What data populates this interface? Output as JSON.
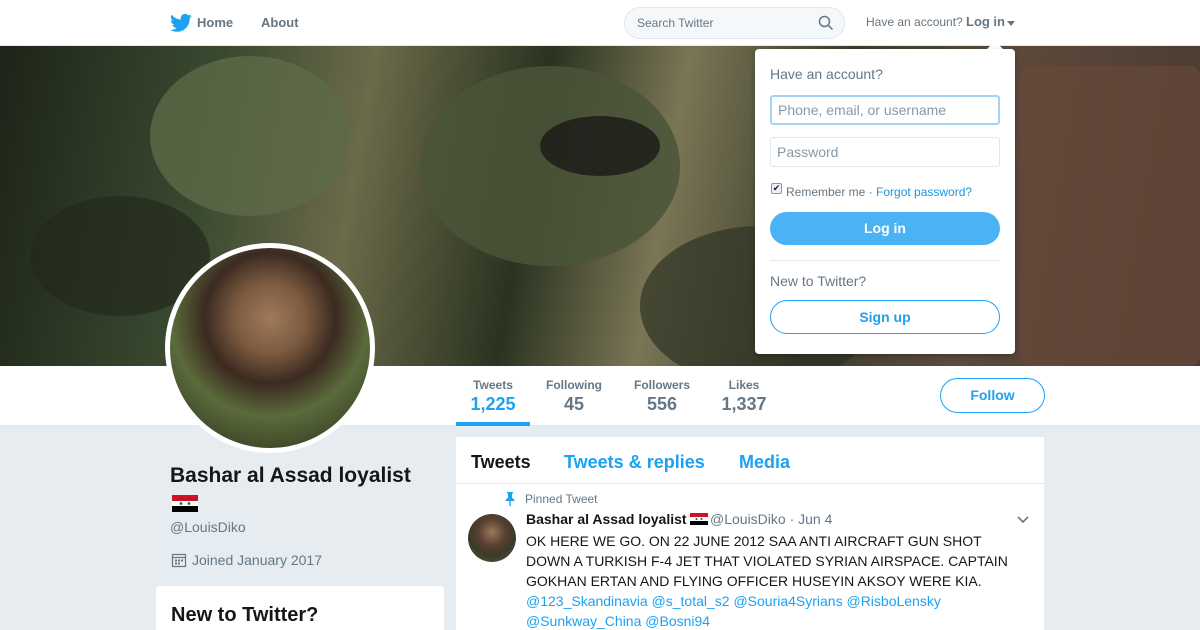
{
  "nav": {
    "home_label": "Home",
    "about_label": "About",
    "search_placeholder": "Search Twitter",
    "login_prompt": "Have an account?",
    "login_label": "Log in",
    "brand_color": "#1da1f2"
  },
  "profile": {
    "name": "Bashar al Assad loyalist",
    "handle": "@LouisDiko",
    "joined": "Joined January 2017",
    "follow_label": "Follow",
    "stats": [
      {
        "label": "Tweets",
        "value": "1,225",
        "active": true
      },
      {
        "label": "Following",
        "value": "45",
        "active": false
      },
      {
        "label": "Followers",
        "value": "556",
        "active": false
      },
      {
        "label": "Likes",
        "value": "1,337",
        "active": false
      }
    ]
  },
  "sidebar": {
    "new_to_twitter_title": "New to Twitter?"
  },
  "timeline": {
    "tabs": [
      {
        "label": "Tweets",
        "active": true
      },
      {
        "label": "Tweets & replies",
        "active": false
      },
      {
        "label": "Media",
        "active": false
      }
    ],
    "pinned_label": "Pinned Tweet",
    "tweet": {
      "author_name": "Bashar al Assad loyalist",
      "handle": "@LouisDiko",
      "separator": "·",
      "date": "Jun 4",
      "text": "OK HERE WE GO.  ON 22 JUNE 2012 SAA ANTI AIRCRAFT GUN SHOT DOWN A TURKISH F-4 JET THAT VIOLATED SYRIAN AIRSPACE. CAPTAIN GOKHAN ERTAN AND FLYING OFFICER HUSEYIN AKSOY WERE KIA.",
      "mentions": "@123_Skandinavia  @s_total_s2 @Souria4Syrians @RisboLensky @Sunkway_China @Bosni94"
    }
  },
  "login_dropdown": {
    "title": "Have an account?",
    "username_placeholder": "Phone, email, or username",
    "password_placeholder": "Password",
    "remember_label": "Remember me",
    "separator": " · ",
    "forgot_label": "Forgot password?",
    "login_button": "Log in",
    "new_label": "New to Twitter?",
    "signup_button": "Sign up"
  }
}
